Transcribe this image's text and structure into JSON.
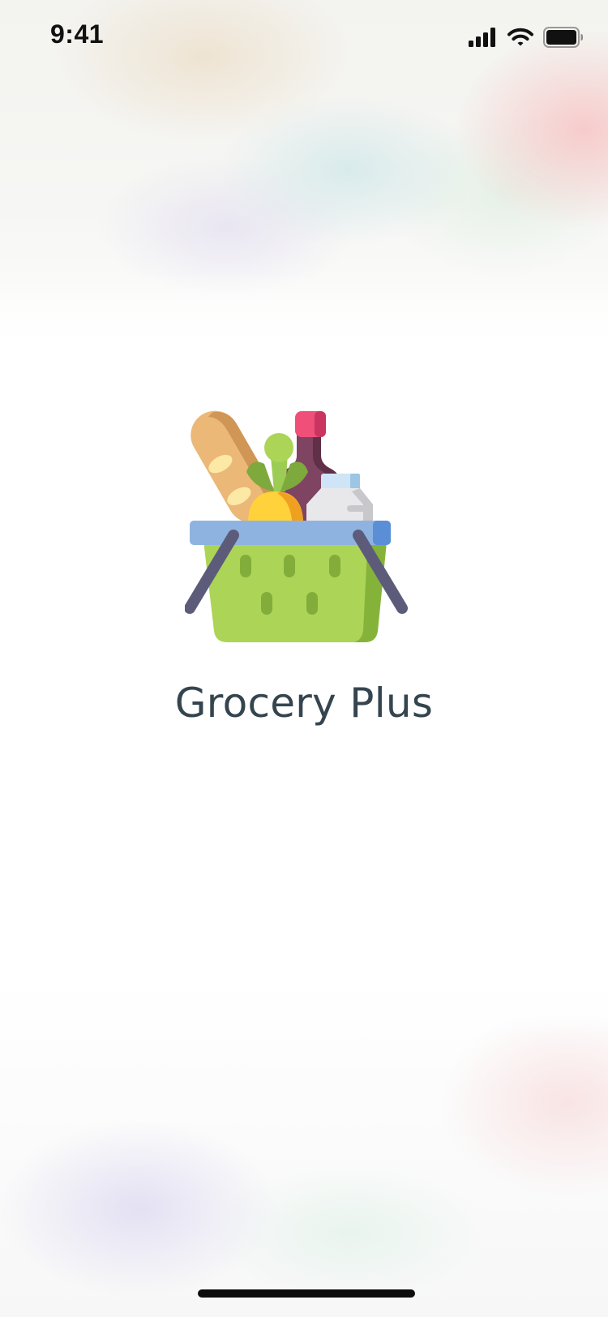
{
  "status_bar": {
    "time": "9:41",
    "icons": [
      "cellular-signal-icon",
      "wifi-icon",
      "battery-icon"
    ]
  },
  "splash": {
    "logo_icon": "grocery-basket-icon",
    "app_name": "Grocery Plus"
  },
  "colors": {
    "title_text": "#35454f",
    "basket_green": "#acd456",
    "basket_rim": "#8fb3e0",
    "handle": "#5c5c7a",
    "bread": "#ebb878",
    "bottle": "#7e4462",
    "bottle_cap": "#ef4f78",
    "carrot": "#ffd23c",
    "milk": "#e8e8ea"
  }
}
